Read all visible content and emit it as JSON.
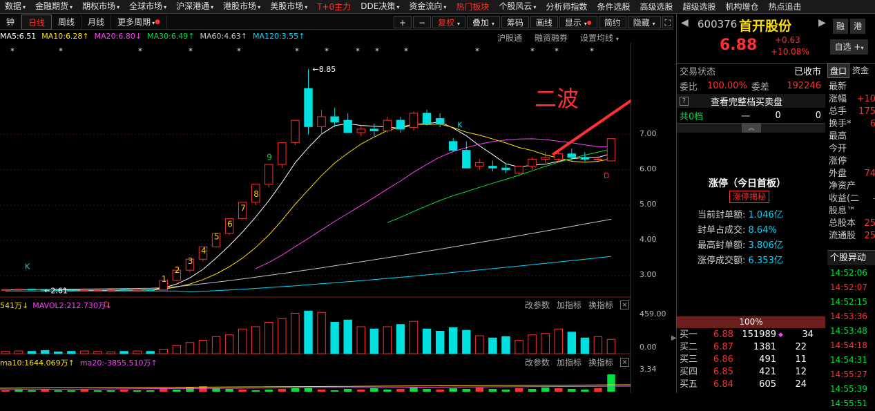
{
  "top_menu": [
    {
      "label": "数据",
      "dd": true
    },
    {
      "label": "金融期货",
      "dd": true
    },
    {
      "label": "期权市场",
      "dd": true
    },
    {
      "label": "全球市场",
      "dd": true
    },
    {
      "label": "沪深港通",
      "dd": true
    },
    {
      "label": "港股市场",
      "dd": true
    },
    {
      "label": "美股市场",
      "dd": true
    },
    {
      "label": "T+0主力",
      "dd": false,
      "style": "red"
    },
    {
      "label": "DDE决策",
      "dd": true
    },
    {
      "label": "资金流向",
      "dd": true
    },
    {
      "label": "热门板块",
      "dd": false,
      "style": "hot"
    },
    {
      "label": "个股风云",
      "dd": true
    },
    {
      "label": "分析师指数",
      "dd": false
    },
    {
      "label": "条件选股",
      "dd": false
    },
    {
      "label": "高级选股",
      "dd": false
    },
    {
      "label": "超级选股",
      "dd": false
    },
    {
      "label": "机构增仓",
      "dd": false
    },
    {
      "label": "热点追击",
      "dd": false
    }
  ],
  "tabs": {
    "minute": "钟",
    "daily": "日线",
    "weekly": "周线",
    "monthly": "月线",
    "more": "更多周期"
  },
  "toolbar": {
    "plus": "+",
    "minus": "−",
    "fuquan": "复权",
    "diejia": "叠加",
    "chouma": "筹码",
    "huaxian": "画线",
    "xianshi": "显示",
    "jianjie": "简约",
    "yincang": "隐藏"
  },
  "ma_legend": [
    {
      "label": "MA5:6.51",
      "color": "#ffffff",
      "arrow": ""
    },
    {
      "label": "MA10:6.28",
      "color": "#ffe000",
      "arrow": "↑"
    },
    {
      "label": "MA20:6.80",
      "color": "#ff40ff",
      "arrow": "↓"
    },
    {
      "label": "MA30:6.49",
      "color": "#00e040",
      "arrow": "↑"
    },
    {
      "label": "MA60:4.63",
      "color": "#c8c8c8",
      "arrow": "↑"
    },
    {
      "label": "MA120:3.55",
      "color": "#00d8ff",
      "arrow": "↑"
    }
  ],
  "chart_links": {
    "hgt": "沪股通",
    "rzrq": "融资融券",
    "ma_setting": "设置均线"
  },
  "annotation": {
    "text": "二波",
    "color": "#ff3030"
  },
  "price_labels": {
    "high": "8.85",
    "low": "2.61"
  },
  "wave_numbers": [
    "1",
    "2",
    "3",
    "4",
    "5",
    "6",
    "7",
    "8",
    "9"
  ],
  "markers": {
    "k1": "K",
    "k2": "K",
    "d1": "D",
    "d2": "D",
    "star": "*"
  },
  "y_axis": [
    "7.00",
    "6.00",
    "5.00",
    "4.00",
    "3.00"
  ],
  "chart_data": {
    "type": "candlestick",
    "ohlc": [
      [
        2.6,
        2.62,
        2.58,
        2.61
      ],
      [
        2.61,
        2.63,
        2.59,
        2.62
      ],
      [
        2.62,
        2.64,
        2.6,
        2.61
      ],
      [
        2.61,
        2.62,
        2.58,
        2.6
      ],
      [
        2.6,
        2.62,
        2.57,
        2.59
      ],
      [
        2.59,
        2.61,
        2.56,
        2.58
      ],
      [
        2.58,
        2.6,
        2.57,
        2.59
      ],
      [
        2.59,
        2.61,
        2.57,
        2.6
      ],
      [
        2.6,
        2.62,
        2.58,
        2.61
      ],
      [
        2.61,
        2.63,
        2.59,
        2.6
      ],
      [
        2.6,
        2.62,
        2.58,
        2.61
      ],
      [
        2.61,
        2.62,
        2.59,
        2.6
      ],
      [
        2.6,
        2.87,
        2.6,
        2.87
      ],
      [
        2.87,
        3.16,
        2.85,
        3.16
      ],
      [
        3.16,
        3.47,
        3.1,
        3.47
      ],
      [
        3.47,
        3.82,
        3.4,
        3.82
      ],
      [
        3.82,
        4.2,
        3.8,
        4.2
      ],
      [
        4.2,
        4.62,
        4.15,
        4.62
      ],
      [
        4.62,
        5.08,
        4.6,
        5.08
      ],
      [
        5.08,
        5.59,
        5.0,
        5.59
      ],
      [
        5.59,
        6.15,
        5.5,
        6.15
      ],
      [
        6.15,
        6.77,
        6.05,
        6.77
      ],
      [
        6.77,
        7.4,
        6.7,
        7.4
      ],
      [
        8.3,
        8.85,
        7.0,
        7.22
      ],
      [
        7.22,
        7.7,
        7.0,
        7.5
      ],
      [
        7.5,
        7.75,
        7.2,
        7.35
      ],
      [
        7.4,
        7.6,
        7.05,
        7.05
      ],
      [
        7.05,
        7.25,
        6.95,
        7.15
      ],
      [
        7.15,
        7.3,
        6.95,
        7.1
      ],
      [
        7.1,
        7.5,
        7.05,
        7.4
      ],
      [
        7.4,
        7.5,
        7.05,
        7.15
      ],
      [
        7.2,
        7.65,
        7.1,
        7.6
      ],
      [
        7.6,
        7.7,
        7.25,
        7.3
      ],
      [
        7.45,
        7.6,
        7.2,
        7.3
      ],
      [
        6.8,
        6.9,
        6.5,
        6.55
      ],
      [
        6.55,
        6.8,
        6.1,
        6.05
      ],
      [
        6.1,
        6.3,
        6.0,
        6.2
      ],
      [
        6.1,
        6.25,
        5.95,
        6.05
      ],
      [
        6.05,
        6.15,
        5.9,
        6.0
      ],
      [
        5.9,
        6.1,
        5.85,
        6.1
      ],
      [
        6.1,
        6.35,
        6.0,
        6.3
      ],
      [
        6.3,
        6.5,
        6.2,
        6.35
      ],
      [
        6.3,
        6.55,
        6.2,
        6.45
      ],
      [
        6.45,
        6.6,
        6.25,
        6.35
      ],
      [
        6.35,
        6.5,
        6.2,
        6.3
      ],
      [
        6.3,
        6.4,
        6.25,
        6.3
      ],
      [
        6.25,
        6.88,
        6.25,
        6.88
      ]
    ],
    "ylim": [
      2.4,
      9.2
    ],
    "volume_axis": [
      "459.00",
      "0.00"
    ],
    "indicator_axis": "3.34"
  },
  "vol_legend": [
    {
      "label": "541万",
      "color": "#ffe000",
      "arrow": "↓"
    },
    {
      "label": "MAVOL2:212.730万",
      "color": "#ff40ff",
      "arrow": "↓"
    }
  ],
  "panel_tools": {
    "change_params": "改参数",
    "add_indicator": "加指标",
    "switch_indicator": "换指标",
    "close": "×"
  },
  "ind_legend": [
    {
      "label": "ma10:1644.069万",
      "color": "#ffe000",
      "arrow": "↑"
    },
    {
      "label": "ma20:-3855.510万",
      "color": "#ff40ff",
      "arrow": "↑"
    }
  ],
  "stock": {
    "code": "600376",
    "name": "首开股份",
    "price": "6.88",
    "change": "+0.63",
    "change_pct": "+10.08%",
    "btn_rong": "融",
    "btn_gang": "港",
    "btn_zixuan": "自选"
  },
  "quote": {
    "status_label": "交易状态",
    "status_value": "已收市",
    "weibi_label": "委比",
    "weibi_value": "100.00%",
    "weicha_label": "委差",
    "weicha_value": "192246",
    "full_book": "查看完整档买卖盘",
    "gong_label": "共0档",
    "gong_dash": "一",
    "gong_v1": "0",
    "gong_v2": "0",
    "zt_title": "涨停（今日首板）",
    "zt_btn": "涨停揭秘",
    "fd_label": "当前封单额:",
    "fd_value": "1.046亿",
    "fdzb_label": "封单占成交:",
    "fdzb_value": "8.64%",
    "zgfd_label": "最高封单额:",
    "zgfd_value": "3.806亿",
    "ztcj_label": "涨停成交额:",
    "ztcj_value": "6.353亿",
    "pct_bar": "100%",
    "bids": [
      {
        "label": "买一",
        "price": "6.88",
        "vol": "151989",
        "num": "34"
      },
      {
        "label": "买二",
        "price": "6.87",
        "vol": "1381",
        "num": "22"
      },
      {
        "label": "买三",
        "price": "6.86",
        "vol": "491",
        "num": "11"
      },
      {
        "label": "买四",
        "price": "6.85",
        "vol": "421",
        "num": "12"
      },
      {
        "label": "买五",
        "price": "6.84",
        "vol": "605",
        "num": "24"
      }
    ]
  },
  "side_tabs": {
    "pankou": "盘口",
    "zijin": "资金"
  },
  "side_list": [
    {
      "label": "最新",
      "value": ""
    },
    {
      "label": "涨幅",
      "value": "+10"
    },
    {
      "label": "总手",
      "value": "175"
    },
    {
      "label": "换手*",
      "value": "6"
    },
    {
      "label": "最高",
      "value": ""
    },
    {
      "label": "今开",
      "value": ""
    },
    {
      "label": "涨停",
      "value": ""
    },
    {
      "label": "外盘",
      "value": "74"
    },
    {
      "label": "净资产",
      "value": ""
    },
    {
      "label": "收益(二",
      "value": "-"
    },
    {
      "label": "股息™",
      "value": ""
    },
    {
      "label": "总股本",
      "value": "25"
    },
    {
      "label": "流通股",
      "value": "25"
    }
  ],
  "ticks_title": "个股异动",
  "ticks": [
    {
      "t": "14:52:06",
      "c": "green"
    },
    {
      "t": "14:52:07",
      "c": "red"
    },
    {
      "t": "14:52:15",
      "c": "green"
    },
    {
      "t": "14:53:36",
      "c": "red"
    },
    {
      "t": "14:53:48",
      "c": "green"
    },
    {
      "t": "14:54:18",
      "c": "red"
    },
    {
      "t": "14:54:31",
      "c": "green"
    },
    {
      "t": "14:55:27",
      "c": "red"
    },
    {
      "t": "14:55:39",
      "c": "green"
    },
    {
      "t": "14:55:51",
      "c": "green"
    }
  ]
}
